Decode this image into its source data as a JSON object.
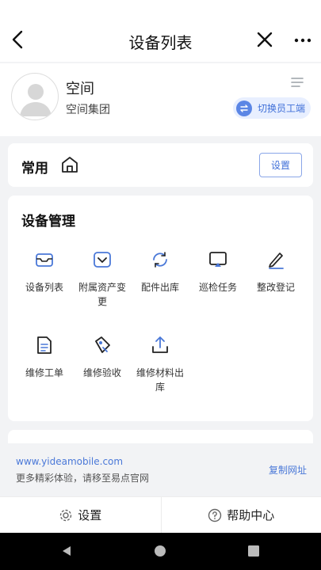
{
  "header": {
    "title": "设备列表",
    "back_icon": "back-arrow-icon",
    "close_icon": "close-icon",
    "more_icon": "more-icon"
  },
  "profile": {
    "name": "空间",
    "group": "空间集团",
    "switch_label": "切换员工端"
  },
  "common": {
    "title": "常用",
    "settings_button": "设置"
  },
  "management": {
    "title": "设备管理",
    "items": [
      {
        "label": "设备列表",
        "icon": "device-list-icon"
      },
      {
        "label": "附属资产变更",
        "icon": "asset-change-icon"
      },
      {
        "label": "配件出库",
        "icon": "parts-outbound-icon"
      },
      {
        "label": "巡检任务",
        "icon": "inspection-task-icon"
      },
      {
        "label": "整改登记",
        "icon": "rectification-icon"
      },
      {
        "label": "维修工单",
        "icon": "repair-order-icon"
      },
      {
        "label": "维修验收",
        "icon": "repair-acceptance-icon"
      },
      {
        "label": "维修材料出库",
        "icon": "material-outbound-icon"
      }
    ]
  },
  "footer": {
    "url": "www.yideamobile.com",
    "hint": "更多精彩体验，请移至易点官网",
    "copy_label": "复制网址"
  },
  "bottom_bar": {
    "settings": "设置",
    "help": "帮助中心"
  },
  "colors": {
    "accent": "#3f6fd8",
    "icon_blue": "#4a78d8",
    "background": "#f2f3f5"
  }
}
